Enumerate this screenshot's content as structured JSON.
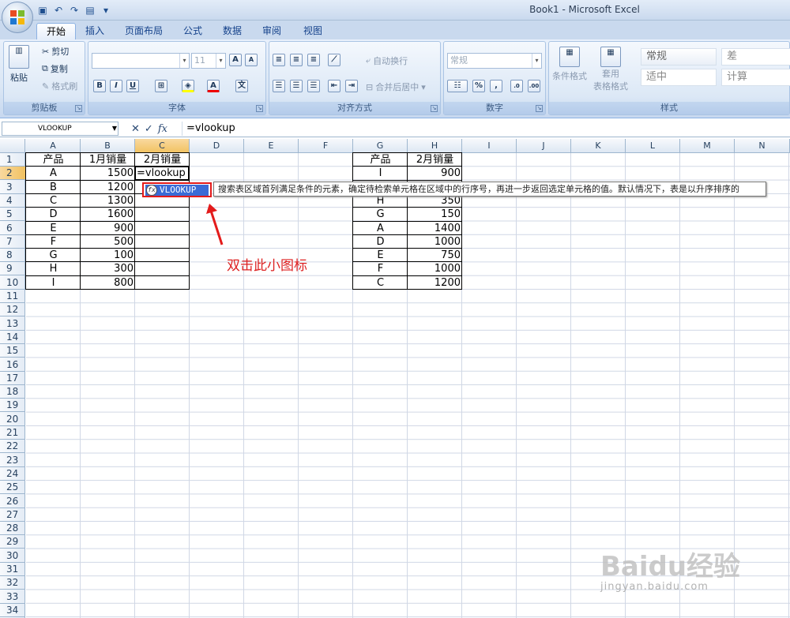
{
  "window": {
    "title": "Book1 - Microsoft Excel"
  },
  "tabs": [
    {
      "label": "开始",
      "active": true
    },
    {
      "label": "插入"
    },
    {
      "label": "页面布局"
    },
    {
      "label": "公式"
    },
    {
      "label": "数据"
    },
    {
      "label": "审阅"
    },
    {
      "label": "视图"
    }
  ],
  "ribbon": {
    "clipboard": {
      "label": "剪贴板",
      "paste": "粘贴",
      "cut": "剪切",
      "copy": "复制",
      "format_painter": "格式刷"
    },
    "font": {
      "label": "字体",
      "size": "11"
    },
    "alignment": {
      "label": "对齐方式",
      "wrap": "自动换行",
      "merge": "合并后居中"
    },
    "number": {
      "label": "数字",
      "format": "常规"
    },
    "styles": {
      "label": "样式",
      "conditional": "条件格式",
      "table_format_1": "套用",
      "table_format_2": "表格格式",
      "normal": "常规",
      "bad": "差",
      "neutral": "适中",
      "calc": "计算"
    }
  },
  "formula_bar": {
    "name_box": "VLOOKUP",
    "formula": "=vlookup"
  },
  "columns": [
    "A",
    "B",
    "C",
    "D",
    "E",
    "F",
    "G",
    "H",
    "I",
    "J",
    "K",
    "L",
    "M",
    "N"
  ],
  "rows": [
    "1",
    "2",
    "3",
    "4",
    "5",
    "6",
    "7",
    "8",
    "9",
    "10",
    "11",
    "12",
    "13",
    "14",
    "15",
    "16",
    "17",
    "18",
    "19",
    "20",
    "21",
    "22",
    "23",
    "24",
    "25",
    "26",
    "27",
    "28",
    "29",
    "30",
    "31",
    "32",
    "33",
    "34"
  ],
  "table1": {
    "headers": [
      "产品",
      "1月销量",
      "2月销量"
    ],
    "rows": [
      [
        "A",
        "1500"
      ],
      [
        "B",
        "1200"
      ],
      [
        "C",
        "1300"
      ],
      [
        "D",
        "1600"
      ],
      [
        "E",
        "900"
      ],
      [
        "F",
        "500"
      ],
      [
        "G",
        "100"
      ],
      [
        "H",
        "300"
      ],
      [
        "I",
        "800"
      ]
    ],
    "editing_cell": "=vlookup"
  },
  "table2": {
    "headers": [
      "产品",
      "2月销量"
    ],
    "rows": [
      [
        "I",
        "900"
      ],
      [
        "",
        ""
      ],
      [
        "H",
        "350"
      ],
      [
        "G",
        "150"
      ],
      [
        "A",
        "1400"
      ],
      [
        "D",
        "1000"
      ],
      [
        "E",
        "750"
      ],
      [
        "F",
        "1000"
      ],
      [
        "C",
        "1200"
      ]
    ]
  },
  "autocomplete": {
    "item": "VLOOKUP",
    "tooltip": "搜索表区域首列满足条件的元素，确定待检索单元格在区域中的行序号，再进一步返回选定单元格的值。默认情况下，表是以升序排序的"
  },
  "annotation": "双击此小图标",
  "watermark": {
    "brand": "Baidu经验",
    "url": "jingyan.baidu.com"
  }
}
